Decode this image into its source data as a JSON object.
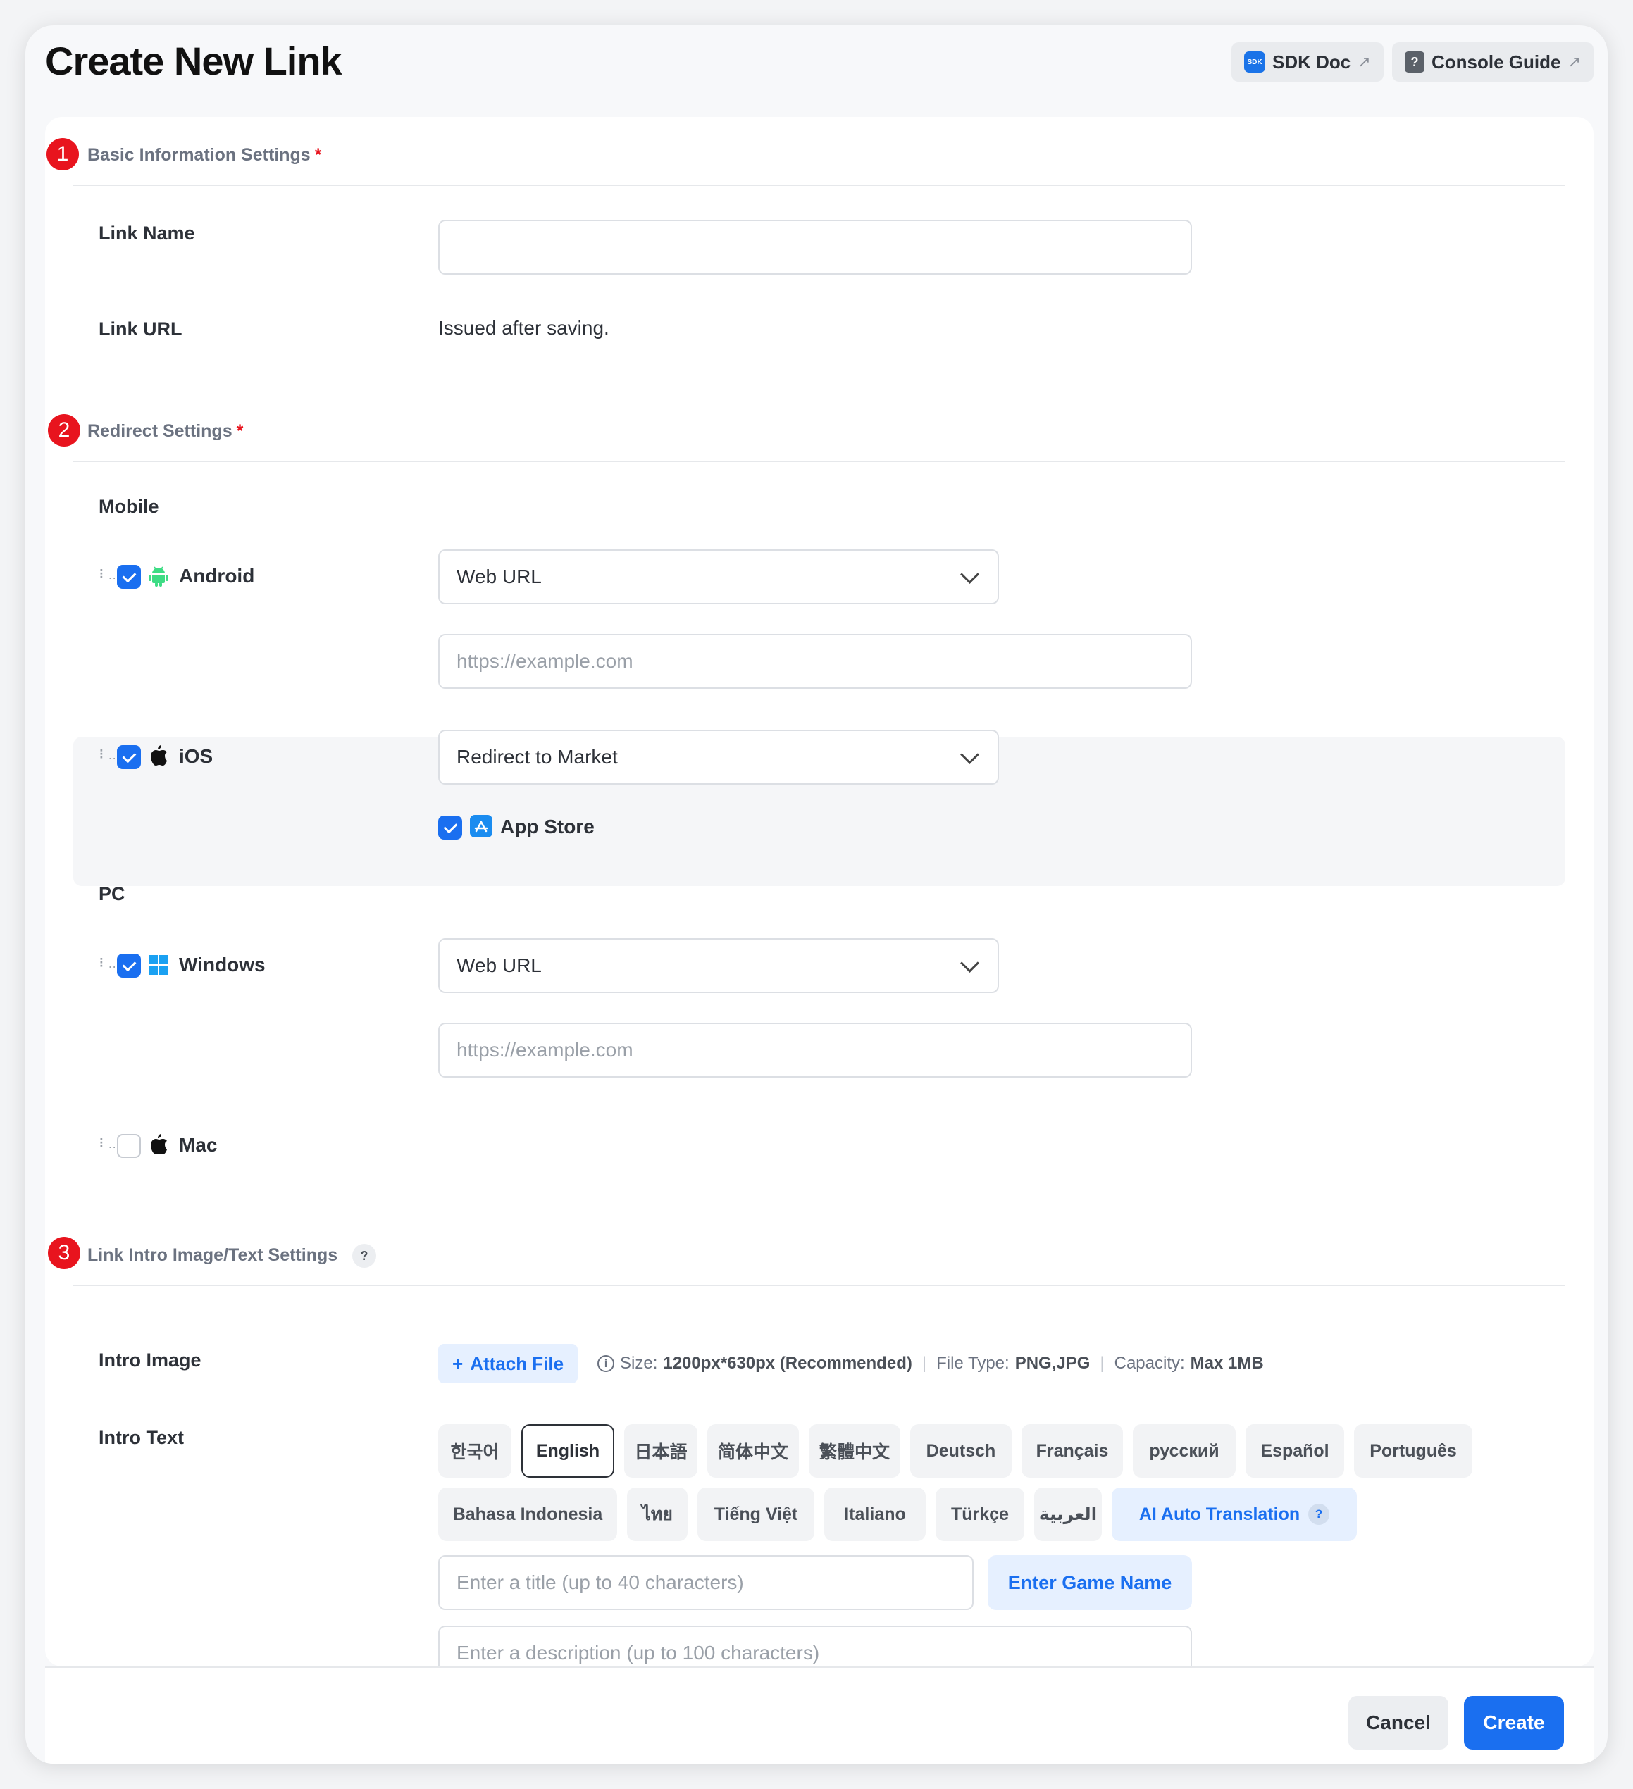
{
  "header": {
    "title": "Create New Link",
    "sdk_doc": "SDK Doc",
    "console_guide": "Console Guide",
    "sdk_icon_text": "SDK",
    "guide_icon_text": "?"
  },
  "sections": {
    "basic": {
      "number": "1",
      "title": "Basic Information Settings",
      "required": "*"
    },
    "redirect": {
      "number": "2",
      "title": "Redirect Settings",
      "required": "*"
    },
    "intro": {
      "number": "3",
      "title": "Link Intro Image/Text Settings",
      "help": "?"
    }
  },
  "basic": {
    "link_name_label": "Link Name",
    "link_name_value": "",
    "link_url_label": "Link URL",
    "link_url_value": "Issued after saving."
  },
  "redirect": {
    "mobile_label": "Mobile",
    "pc_label": "PC",
    "android": {
      "label": "Android",
      "checked": true,
      "select": "Web URL",
      "url_placeholder": "https://example.com"
    },
    "ios": {
      "label": "iOS",
      "checked": true,
      "select": "Redirect to Market",
      "store": "App Store",
      "store_checked": true
    },
    "windows": {
      "label": "Windows",
      "checked": true,
      "select": "Web URL",
      "url_placeholder": "https://example.com"
    },
    "mac": {
      "label": "Mac",
      "checked": false
    }
  },
  "intro": {
    "image_label": "Intro Image",
    "attach_label": "Attach File",
    "attach_icon": "+",
    "size_label": "Size:",
    "size_value": "1200px*630px (Recommended)",
    "type_label": "File Type:",
    "type_value": "PNG,JPG",
    "capacity_label": "Capacity:",
    "capacity_value": "Max 1MB",
    "text_label": "Intro Text",
    "languages_row1": [
      "한국어",
      "English",
      "日本語",
      "简体中文",
      "繁體中文",
      "Deutsch",
      "Français",
      "русский",
      "Español",
      "Português"
    ],
    "languages_row2": [
      "Bahasa Indonesia",
      "ไทย",
      "Tiếng Việt",
      "Italiano",
      "Türkçe",
      "العربية"
    ],
    "selected_language": "English",
    "ai_translation": "AI Auto Translation",
    "title_placeholder": "Enter a title (up to 40 characters)",
    "game_name_button": "Enter Game Name",
    "desc_placeholder": "Enter a description (up to 100 characters)"
  },
  "footer": {
    "cancel": "Cancel",
    "create": "Create"
  },
  "colors": {
    "primary": "#1a6ff0",
    "badge": "#e8141e",
    "android": "#3ddc84",
    "windows": "#1aa1f2"
  }
}
